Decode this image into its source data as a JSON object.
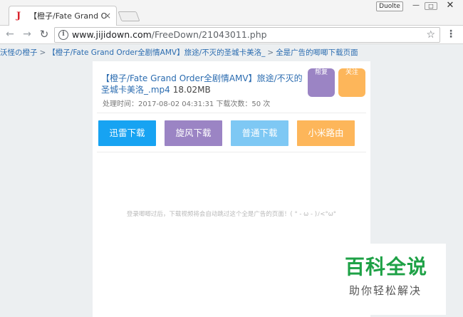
{
  "browser": {
    "tab_title": "【橙子/Fate Grand Orde",
    "tab_favicon_glyph": "J",
    "profile_label": "Duolte",
    "url_host": "www.jijidown.com",
    "url_path": "/FreeDown/21043011.php"
  },
  "page": {
    "breadcrumb": {
      "items": [
        "沃怪の橙子",
        "【橙子/Fate Grand Order全剧情AMV】旅途/不灭的圣城卡美洛_",
        "全是广告的唧唧下载页面"
      ],
      "separator": ">"
    },
    "file": {
      "title": "【橙子/Fate Grand Order全剧情AMV】旅途/不灭的圣城卡美洛_.mp4",
      "size": "18.02MB",
      "meta": "处理时间：2017-08-02 04:31:31 下载次数：50 次"
    },
    "corner_buttons": [
      {
        "label": "帮复"
      },
      {
        "label": "关注"
      }
    ],
    "download_buttons": [
      {
        "label": "迅雷下载",
        "color": "#17a3f2"
      },
      {
        "label": "旋风下载",
        "color": "#9b84c4"
      },
      {
        "label": "普通下载",
        "color": "#7ec8f4"
      },
      {
        "label": "小米路由",
        "color": "#fdb65a"
      }
    ],
    "notice": "登录唧唧过后，下载视频将会自动跳过这个全是广告的页面！( ° - ω - )ﾉ<°ω°"
  },
  "watermark": {
    "title": "百科全说",
    "subtitle": "助你轻松解决"
  },
  "colors": {
    "link": "#2b6cb0",
    "watermark_green": "#1ea146"
  }
}
